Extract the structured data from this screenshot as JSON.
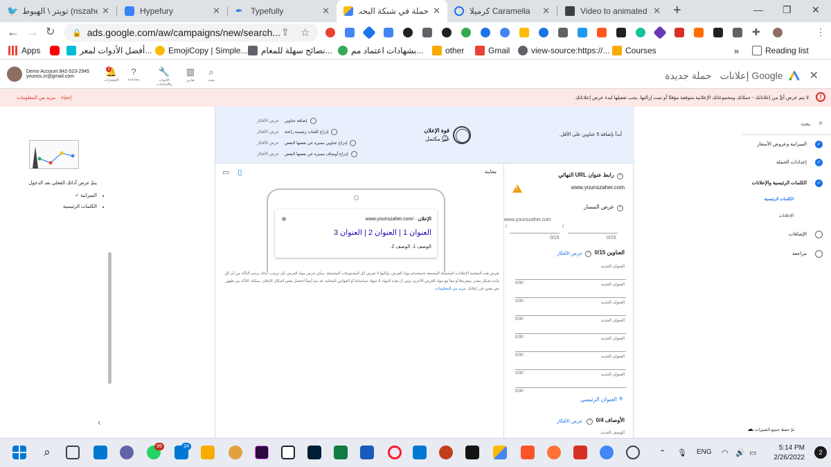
{
  "browser": {
    "tabs": [
      {
        "title": "تويتر \\ الهبوط (nszaher"
      },
      {
        "title": "Hypefury"
      },
      {
        "title": "Typefully"
      },
      {
        "title": "حملة في شبكة البحث -"
      },
      {
        "title": "كرميلا Caramella"
      },
      {
        "title": "Video to animated GIF"
      }
    ],
    "url": "ads.google.com/aw/campaigns/new/search...",
    "bookmarks": [
      "Apps",
      "أفضل الأدوات لمعر...",
      "EmojiCopy | Simple...",
      "نصائح سهلة للمعام...",
      "بشهادات اعتماد مم...",
      "other",
      "Gmail",
      "view-source:https://...",
      "Courses"
    ],
    "reading_list": "Reading list",
    "more": "»"
  },
  "ads_header": {
    "account_name": "Demo Account 842-523-2945",
    "account_email": "younss.zr@gmail.com",
    "tools": [
      {
        "label": "الإشعارات",
        "badge": "1"
      },
      {
        "label": "مساعدة"
      },
      {
        "label": "الأدوات والإعدادات"
      },
      {
        "label": "تقارير"
      },
      {
        "label": "بحث"
      }
    ],
    "brand": "إعلانات Google",
    "page_title": "حملة جديدة"
  },
  "error_banner": {
    "message": "لا يتم عرض أيٍّ من إعلاناتك - حملاتك ومجموعاتك الإعلانية متوقفة مؤقتًا أو تمت إزالتها. يجب تفعيلها لبدء عرض إعلاناتك.",
    "dismiss": "إخفاء",
    "learn_more": "مزيد من المعلومات"
  },
  "left_panel": {
    "tip": "يتمّ عرض أدائك الفعلي بعد الدخول",
    "items": [
      "الميزانية ✓",
      "الكلمات الرئيسية"
    ]
  },
  "ad_strength": {
    "hint": "أبدأ بإضافة 5 عناوين على الأقل.",
    "label": "قوة الإعلان",
    "status": "غير مكتمل",
    "checklist": [
      {
        "label": "إضافة عناوين",
        "action": "عرض الأفكار"
      },
      {
        "label": "إدراج كلمات رئيسية رائجة",
        "action": "عرض الأفكار"
      },
      {
        "label": "إدراج عناوين مميزة عن بعضها البعض",
        "action": "عرض الأفكار"
      },
      {
        "label": "إدراج أوصاف مميزة عن بعضها البعض",
        "action": "عرض الأفكار"
      }
    ]
  },
  "form": {
    "final_url_label": "رابط عنوان URL النهائي",
    "final_url_value": "www.younszaher.com",
    "display_path_label": "عرض المسار",
    "display_path_base": "www.younszaher.com",
    "path_counters": [
      "0/15",
      "0/15"
    ],
    "headlines_label": "العناوين 0/15",
    "show_ideas": "عرض الأفكار",
    "headline_placeholder": "العنوان الجديد",
    "headline_counter": "0/30",
    "add_headline": "العنوان الرئيسي",
    "descriptions_label": "الأوصاف 0/4",
    "description_placeholder": "الوصف الجديد"
  },
  "preview": {
    "title": "معاينة",
    "ad_label": "الإعلان",
    "display_url": "www.younszaher.com/",
    "headline": "العنوان 1 | العنوان 2 | العنوان 3",
    "description": "الوصف 1. الوصف 2.",
    "disclaimer": "تعرض هذه المعاينة الإعلانات المحتملة المجمعة باستخدام مواد العرض، ولكنها لا تعرض كل المجموعات المحتملة. يمكن عرض مواد العرض بأي ترتيب، لذلك يرجى التأكد من أن كل مادة تشكل معنى بمفردها أو معاً مع مواد العرض الأخرى، ومن أن هذه المواد لا تنتهك سياساتنا أو القوانين المحلية. قد يتم أيضاً اختصار بعض أشكال الإعلان. يمكنك التأكد من ظهور نص معين في إعلانك.",
    "learn_more": "مزيد من المعلومات"
  },
  "steps": {
    "search_label": "بحث",
    "items": [
      {
        "label": "الميزانية وعروض الأسعار",
        "done": true
      },
      {
        "label": "إعدادات الحملة",
        "done": true
      },
      {
        "label": "الكلمات الرئيسية والإعلانات",
        "done": true
      },
      {
        "label": "الإضافات",
        "done": false
      },
      {
        "label": "مراجعة",
        "done": false
      }
    ],
    "sub_items": [
      "الكلمات الرئيسية",
      "الإعلانات"
    ],
    "saved": "تمّ حفظ جميع التغييرات."
  },
  "taskbar": {
    "badges": [
      "99",
      "24"
    ],
    "lang": "ENG",
    "time": "5:14 PM",
    "date": "2/26/2022",
    "notifications": "2"
  },
  "colors": {
    "accent": "#1a73e8",
    "error": "#d93025",
    "warning": "#f29900",
    "banner": "#fce8e6",
    "strength_bg": "#e8f0fe"
  }
}
